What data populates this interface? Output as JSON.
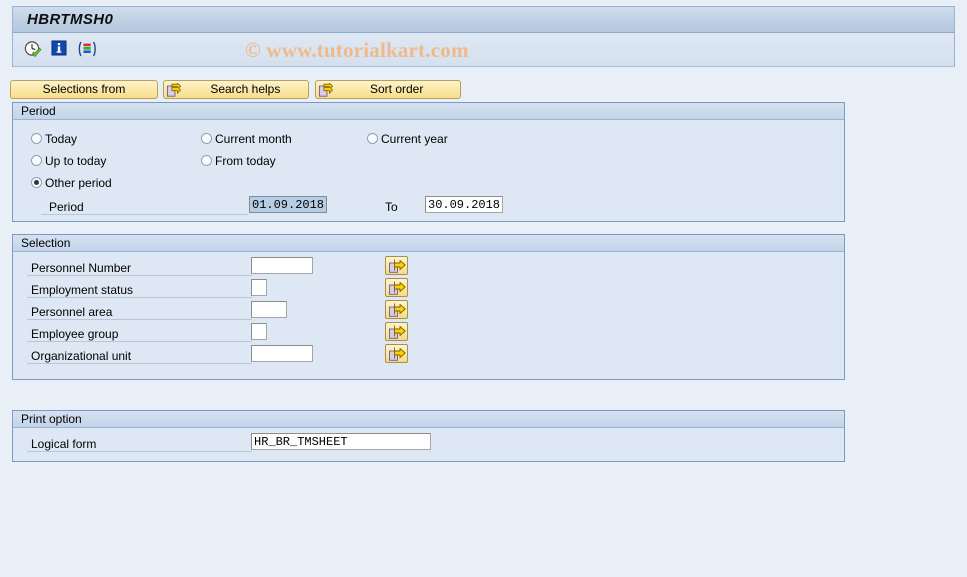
{
  "window": {
    "title": "HBRTMSH0"
  },
  "watermark": {
    "text": "© www.tutorialkart.com"
  },
  "toolbar": {
    "icons": [
      {
        "name": "execute-clock-icon",
        "title": "Execute"
      },
      {
        "name": "information-icon",
        "title": "Information"
      },
      {
        "name": "variant-icon",
        "title": "Get Variant"
      }
    ]
  },
  "buttons": {
    "selections_from": "Selections from",
    "search_helps": "Search helps",
    "sort_order": "Sort order"
  },
  "period": {
    "legend": "Period",
    "options": [
      {
        "label": "Today",
        "selected": false
      },
      {
        "label": "Current month",
        "selected": false
      },
      {
        "label": "Current year",
        "selected": false
      },
      {
        "label": "Up to today",
        "selected": false
      },
      {
        "label": "From today",
        "selected": false
      },
      {
        "label": "Other period",
        "selected": true
      }
    ],
    "period_label": "Period",
    "period_from_value": "01.09.2018",
    "to_label": "To",
    "period_to_value": "30.09.2018"
  },
  "selection": {
    "legend": "Selection",
    "fields": [
      {
        "label": "Personnel Number",
        "value": ""
      },
      {
        "label": "Employment status",
        "value": ""
      },
      {
        "label": "Personnel area",
        "value": ""
      },
      {
        "label": "Employee group",
        "value": ""
      },
      {
        "label": "Organizational unit",
        "value": ""
      }
    ]
  },
  "print_option": {
    "legend": "Print option",
    "logical_form_label": "Logical form",
    "logical_form_value": "HR_BR_TMSHEET"
  },
  "colors": {
    "page_background": "#e9eff7",
    "panel_background": "#dde8f4",
    "panel_border": "#7d9bc1",
    "button_yellow": "#fbe8a8",
    "title_bar": "#bfd0e4",
    "watermark": "#f0b98a",
    "selected_field": "#b7cde4"
  }
}
